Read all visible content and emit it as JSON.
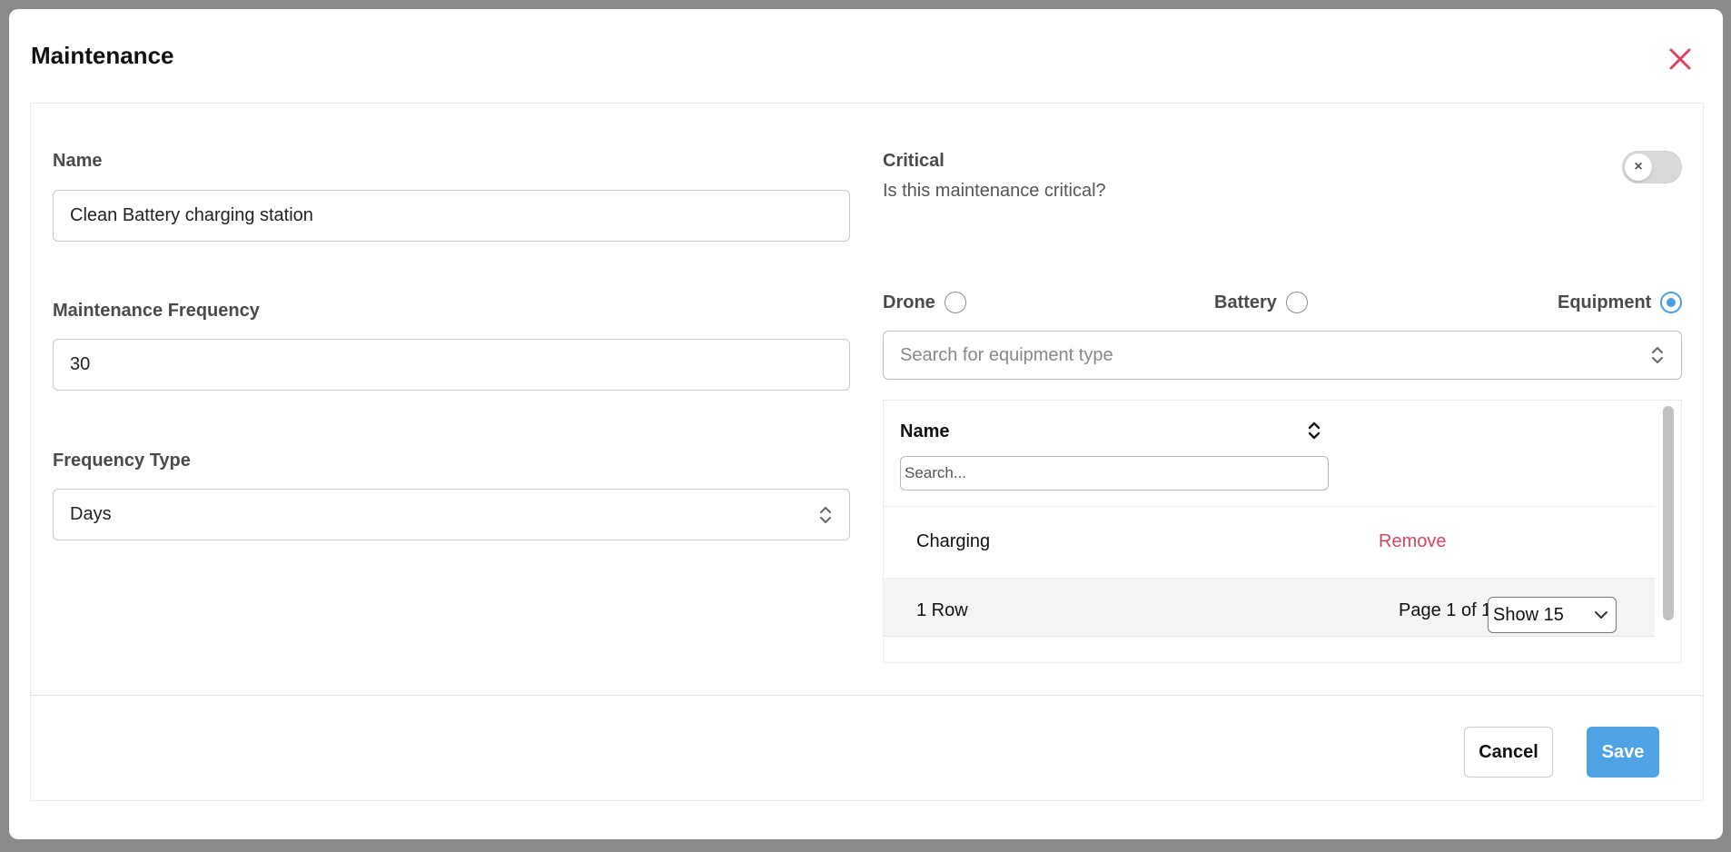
{
  "modal": {
    "title": "Maintenance"
  },
  "form": {
    "name_label": "Name",
    "name_value": "Clean Battery charging station",
    "frequency_label": "Maintenance Frequency",
    "frequency_value": "30",
    "frequency_type_label": "Frequency Type",
    "frequency_type_value": "Days",
    "critical_label": "Critical",
    "critical_description": "Is this maintenance critical?",
    "critical_enabled": false
  },
  "asset_type": {
    "options": [
      {
        "label": "Drone",
        "checked": false
      },
      {
        "label": "Battery",
        "checked": false
      },
      {
        "label": "Equipment",
        "checked": true
      }
    ],
    "search_placeholder": "Search for equipment type"
  },
  "table": {
    "column_header": "Name",
    "search_placeholder": "Search...",
    "rows": [
      {
        "name": "Charging",
        "action": "Remove"
      }
    ],
    "row_count": "1 Row",
    "page_info": "Page 1 of 1",
    "page_size": "Show 15"
  },
  "footer": {
    "cancel_label": "Cancel",
    "save_label": "Save"
  },
  "colors": {
    "accent": "#4da3e6",
    "danger": "#d9455f"
  },
  "icons": {
    "close": "close-icon",
    "select": "chevron-up-down-icon",
    "sort": "sort-icon",
    "dropdown": "chevron-down-icon",
    "toggle_off": "x-icon"
  }
}
